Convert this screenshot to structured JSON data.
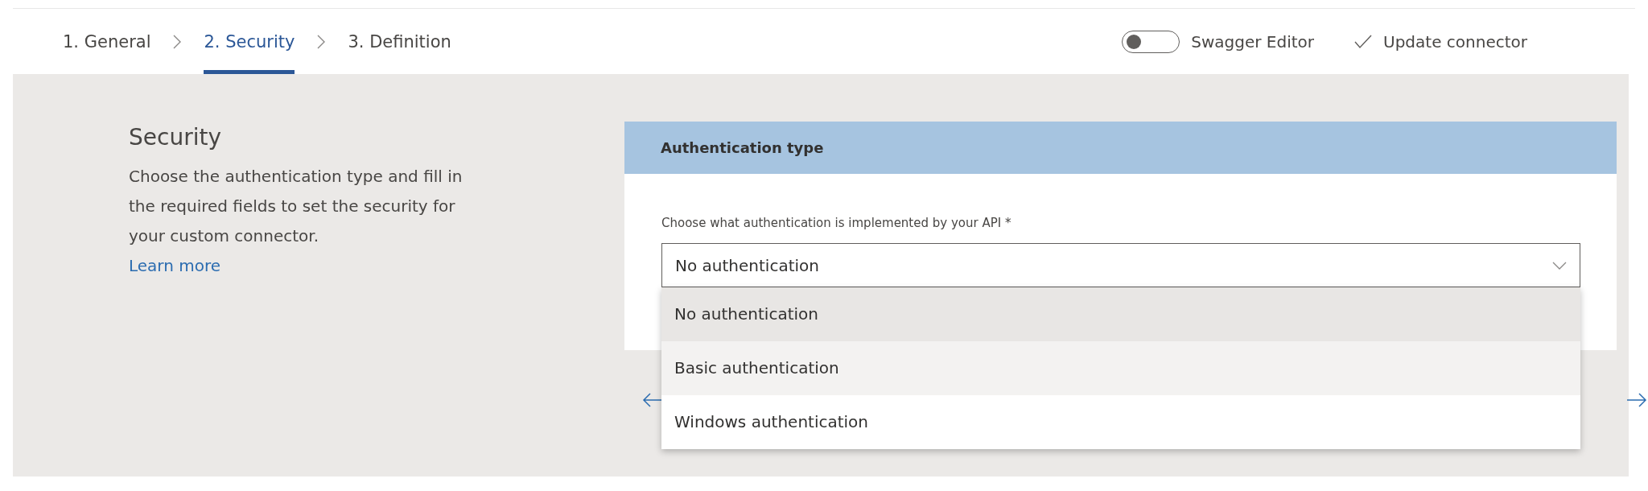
{
  "steps": [
    {
      "label": "1. General",
      "selected": false
    },
    {
      "label": "2. Security",
      "selected": true
    },
    {
      "label": "3. Definition",
      "selected": false
    }
  ],
  "toolbar": {
    "swagger_editor": {
      "label": "Swagger Editor",
      "on": false
    },
    "update_connector": {
      "label": "Update connector"
    }
  },
  "intro": {
    "title": "Security",
    "description": "Choose the authentication type and fill in the required fields to set the security for your custom connector.",
    "link": "Learn more"
  },
  "auth_card": {
    "header": "Authentication type",
    "field_label": "Choose what authentication is implemented by your API *",
    "value": "No authentication",
    "expanded": true,
    "options": [
      {
        "label": "No authentication",
        "selected": true,
        "hovered": false
      },
      {
        "label": "Basic authentication",
        "selected": false,
        "hovered": true
      },
      {
        "label": "Windows authentication",
        "selected": false,
        "hovered": false
      }
    ]
  }
}
